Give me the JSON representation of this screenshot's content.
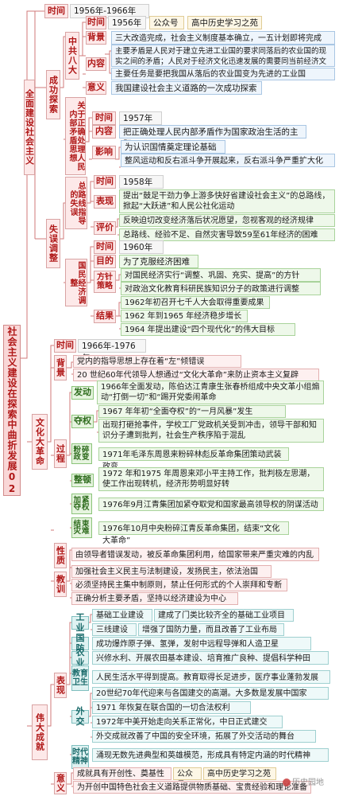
{
  "root": {
    "title": "社会主义建设在探索中曲折发展02"
  },
  "s1": {
    "title": "全面建设社会主义",
    "time_label": "时间",
    "time": "1956年-1966年",
    "success": {
      "label": "成功探索",
      "bada": {
        "label": "中共八大",
        "time_label": "时间",
        "time": "1956年",
        "tag1": "公众号",
        "tag2": "高中历史学习之苑",
        "bg_label": "背景",
        "bg": "三大改造完成，社会主义制度基本确立，一五计划即将完成",
        "content_label": "内容",
        "content1": "主要矛盾是人民对于建立先进工业国的要求同落后的农业国的现实之间的矛盾；人民对于经济文化迅速发展的需要同当前经济文化不能满足需要的状况之间的矛盾",
        "content2": "主要任务是要把我国从落后的农业国变为先进的工业国",
        "meaning_label": "意义",
        "meaning": "我国建设社会主义道路的一次成功探索"
      },
      "maodun": {
        "label": "关于正确处理人民内部矛盾思想",
        "time_label": "时间",
        "time": "1957年",
        "content_label": "内容",
        "content": "把正确处理人民内部矛盾作为国家政治生活的主题",
        "impact_label": "影响",
        "impact1": "为认识国情奠定理论基础",
        "impact2": "整风运动和反右派斗争开展起来，反右派斗争严重扩大化"
      }
    },
    "mistake": {
      "label": "失误调整",
      "zongluxian": {
        "label": "总路线指导的失误",
        "time_label": "时间",
        "time": "1958年",
        "show_label": "表现",
        "show": "提出“鼓足干劲力争上游多快好省建设社会主义”的总路线，掀起“大跃进”和人民公社化运动",
        "eval_label": "评价",
        "eval1": "反映迫切改变经济落后状况愿望，忽视客观的经济规律",
        "eval2": "总路线、经验不足、自然灾害导致59至61年经济的困难"
      },
      "tiaozheng": {
        "label": "国民经济调整",
        "time_label": "时间",
        "time": "1960年",
        "goal_label": "目的",
        "goal": "为了克服经济困难",
        "policy_label": "方针策略",
        "policy1": "对国民经济实行“调整、巩固、充实、提高”的方针",
        "policy2": "对政治文化教育科研民族知识分子的政策进行调整",
        "result_label": "结果",
        "result0": "1962年初召开七千人大会取得重要成果",
        "result1": "1962 年到1965 年经济稳步增长",
        "result2": "1964 年提出建设“四个现代化”的伟大目标"
      }
    }
  },
  "s2": {
    "title": "文化大革命",
    "time_label": "时间",
    "time": "1966年-1976年",
    "bg_label": "背景",
    "bg1": "党内的指导思想上存在着“左”倾错误",
    "bg2": "20 世纪60年代领导人想通过“文化大革命”来防止资本主义复辟",
    "process_label": "过程",
    "fadong_label": "发动",
    "fadong": "1966年全面发动，陈伯达江青康生张春桥组成中央文革小组煽动“打倒一切”和“踢开党委闹革命",
    "duoquan_label": "夺权",
    "duoquan1": "1967 年年初“全面夺权”的“一月风暴”发生",
    "duoquan2": "出现打砸抢事件，学校工厂党政机关受到冲击，领导干部和知识分子遭到批判，社会生产秩序陷于混乱",
    "fensui_label": "粉碎政变",
    "fensui": "1971年毛泽东周恩来粉碎林彪反革命集团策动武装政变",
    "zhengdun_label": "整顿",
    "zhengdun": "1972 年和1975 年周恩来邓小平主持工作，批判极左思潮，使工作出现转机，经济形势明显好转",
    "jiajin_label": "加紧夺权",
    "jiajin": "1976年9月江青集团加紧夺取党和国家最高领导权的阴谋活动",
    "jieshu_label": "结束灾难",
    "jieshu": "1976年10月中央粉碎江青反革命集团，结束“文化大革命”",
    "nature_label": "性质",
    "nature": "由领导者错误发动，被反革命集团利用，给国家带来严重灾难的内乱",
    "lesson_label": "教训",
    "lesson1": "加强社会主义民主与法制建设，发扬民主，依法治国",
    "lesson2": "必须坚持民主集中制原则，禁止任何形式的个人崇拜和专断",
    "lesson3": "正确分析主要矛盾，坚持以经济建设为中心"
  },
  "s3": {
    "title": "伟大成就",
    "show_label": "表现",
    "industry_label": "工业",
    "industry1": "基础工业建设",
    "industry1b": "建成了门类比较齐全的基础工业项目",
    "industry2": "三线建设",
    "industry2b": "增强了国防力量，而且改善了工业布局",
    "defense_label": "国防",
    "defense": "成功爆炸原子弹、氢弹，发射中远程导弹和人造卫星",
    "agri_label": "农业",
    "agri": "兴修水利、开展农田基本建设、培育推广良种、提倡科学种田",
    "edu_label": "教育卫生",
    "edu": "人民生活水平得到提高。教育取得长足进步，医疗事业蓬勃发展",
    "foreign_label": "外交",
    "foreign0": "20世纪70年代迎来与各国建交的高潮。大多数是发展中国家",
    "foreign1": "1971 年恢复在联合国的一切合法权利",
    "foreign2": "1972年中美开始走向关系正常化，中日正式建交",
    "foreign3": "外交成就改善了中国的安全环境，拓展了外交活动的舞台",
    "spirit_label": "时代精神",
    "spirit": "涌现无数先进典型和英雄模范，形成具有特定内涵的时代精神",
    "meaning_label": "意义",
    "meaning1": "成就具有开创性、奠基性",
    "tag1": "公众号",
    "tag2": "高中历史学习之苑",
    "meaning2": "为开创中国特色社会主义道路提供物质基础、宝贵经验和理论准备"
  },
  "watermark": "历史园地",
  "colors": {
    "label_red": "#b01818",
    "label_bg": "#fde9e9",
    "line": "#d07070"
  }
}
